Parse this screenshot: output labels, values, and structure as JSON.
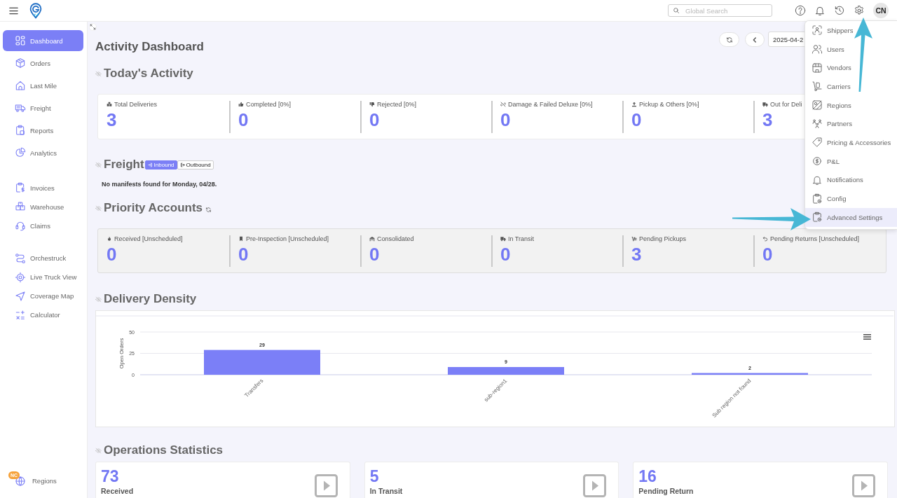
{
  "topbar": {
    "search": {
      "placeholder": "Global Search"
    },
    "avatar": "CN"
  },
  "sidebar": {
    "sections": [
      {
        "items": [
          {
            "label": "Dashboard",
            "selected": true
          },
          {
            "label": "Orders",
            "selected": false
          },
          {
            "label": "Last Mile",
            "selected": false
          },
          {
            "label": "Freight",
            "selected": false
          },
          {
            "label": "Reports",
            "selected": false
          },
          {
            "label": "Analytics",
            "selected": false
          }
        ]
      },
      {
        "items": [
          {
            "label": "Invoices",
            "selected": false
          },
          {
            "label": "Warehouse",
            "selected": false
          },
          {
            "label": "Claims",
            "selected": false
          }
        ]
      },
      {
        "items": [
          {
            "label": "Orchestruck",
            "selected": false
          },
          {
            "label": "Live Truck View",
            "selected": false
          },
          {
            "label": "Coverage Map",
            "selected": false
          },
          {
            "label": "Calculator",
            "selected": false
          }
        ]
      }
    ],
    "footer": {
      "label": "Regions",
      "badge": "NC"
    }
  },
  "header": {
    "title": "Activity Dashboard",
    "date": "2025-04-2"
  },
  "todays_activity": {
    "title": "Today's Activity",
    "stats": [
      {
        "label": "Total Deliveries",
        "value": "3"
      },
      {
        "label": "Completed [0%]",
        "value": "0"
      },
      {
        "label": "Rejected [0%]",
        "value": "0"
      },
      {
        "label": "Damage & Failed Deluxe [0%]",
        "value": "0"
      },
      {
        "label": "Pickup & Others [0%]",
        "value": "0"
      },
      {
        "label": "Out for Deli",
        "value": "3"
      }
    ]
  },
  "freight": {
    "title": "Freight",
    "tabs": [
      {
        "label": "Inbound",
        "selected": true
      },
      {
        "label": "Outbound",
        "selected": false
      }
    ],
    "message": "No manifests found for Monday, 04/28."
  },
  "priority_accounts": {
    "title": "Priority Accounts",
    "stats": [
      {
        "label": "Received [Unscheduled]",
        "value": "0"
      },
      {
        "label": "Pre-Inspection [Unscheduled]",
        "value": "0"
      },
      {
        "label": "Consolidated",
        "value": "0"
      },
      {
        "label": "In Transit",
        "value": "0"
      },
      {
        "label": "Pending Pickups",
        "value": "3"
      },
      {
        "label": "Pending Returns [Unscheduled]",
        "value": "0"
      }
    ]
  },
  "delivery_density": {
    "title": "Delivery Density",
    "chart_data": {
      "type": "bar",
      "ylabel": "Open Orders",
      "categories": [
        "Transfers",
        "sub-region1",
        "Sub region not found"
      ],
      "values": [
        29,
        9,
        2
      ],
      "ylim": [
        0,
        50
      ],
      "yticks": [
        0,
        25,
        50
      ],
      "data_labels": true
    }
  },
  "operations_statistics": {
    "title": "Operations Statistics",
    "cards": [
      {
        "value": "73",
        "label": "Received"
      },
      {
        "value": "5",
        "label": "In Transit"
      },
      {
        "value": "16",
        "label": "Pending Return"
      }
    ]
  },
  "settings_menu": {
    "items": [
      {
        "label": "Shippers",
        "selected": false
      },
      {
        "label": "Users",
        "selected": false
      },
      {
        "label": "Vendors",
        "selected": false
      },
      {
        "label": "Carriers",
        "selected": false
      },
      {
        "label": "Regions",
        "selected": false
      },
      {
        "label": "Partners",
        "selected": false
      },
      {
        "label": "Pricing & Accessories",
        "selected": false
      },
      {
        "label": "P&L",
        "selected": false
      },
      {
        "label": "Notifications",
        "selected": false
      },
      {
        "label": "Config",
        "selected": false
      },
      {
        "label": "Advanced Settings",
        "selected": true
      }
    ]
  }
}
